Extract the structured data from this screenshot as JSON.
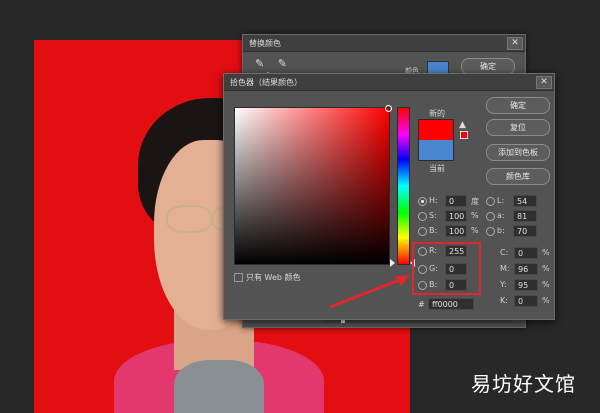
{
  "replace_dialog": {
    "title": "替换颜色",
    "ok_label": "确定",
    "swatch_color": "#4a86cf",
    "partial_label": "颜色"
  },
  "picker": {
    "title": "拾色器（结果颜色）",
    "new_label": "新的",
    "current_label": "当前",
    "new_color": "#ff0000",
    "current_color": "#4a86cf",
    "buttons": {
      "ok": "确定",
      "reset": "复位",
      "add_swatch": "添加到色板",
      "library": "颜色库"
    },
    "web_only_label": "只有 Web 颜色",
    "hsb": {
      "h": "0",
      "h_unit": "度",
      "s": "100",
      "s_unit": "%",
      "b": "100",
      "b_unit": "%"
    },
    "lab": {
      "l": "54",
      "a": "81",
      "b": "70"
    },
    "rgb": {
      "r": "255",
      "g": "0",
      "b": "0"
    },
    "cmyk": {
      "c": "0",
      "m": "96",
      "y": "95",
      "k": "0",
      "unit": "%"
    },
    "hex_label": "#",
    "hex": "ff0000",
    "labels": {
      "H": "H:",
      "S": "S:",
      "B": "B:",
      "L": "L:",
      "a": "a:",
      "b2": "b:",
      "R": "R:",
      "G": "G:",
      "Bc": "B:",
      "C": "C:",
      "M": "M:",
      "Y": "Y:",
      "K": "K:"
    }
  },
  "highlight_color": "#e0262e",
  "watermark": "易坊好文馆"
}
